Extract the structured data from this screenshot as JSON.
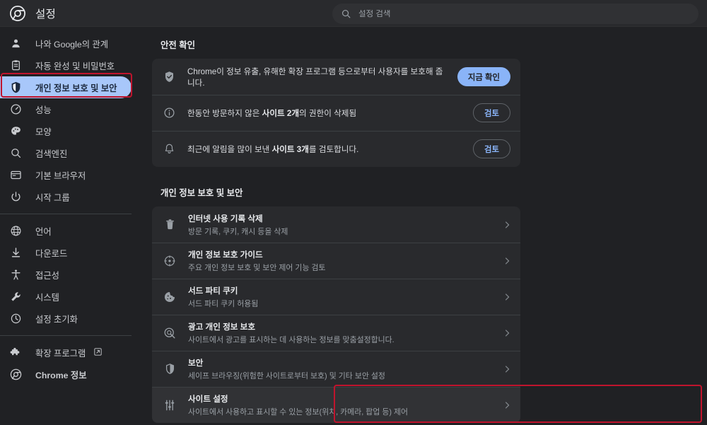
{
  "header": {
    "title": "설정",
    "logo_icon": "chrome-logo-icon"
  },
  "search": {
    "placeholder": "설정 검색",
    "value": "",
    "icon": "search-icon"
  },
  "sidebar": {
    "groups": [
      {
        "items": [
          {
            "label": "나와 Google의 관계",
            "icon": "person-icon",
            "selected": false
          },
          {
            "label": "자동 완성 및 비밀번호",
            "icon": "clipboard-icon",
            "selected": false
          },
          {
            "label": "개인 정보 보호 및 보안",
            "icon": "shield-icon",
            "selected": true
          },
          {
            "label": "성능",
            "icon": "gauge-icon",
            "selected": false
          },
          {
            "label": "모양",
            "icon": "palette-icon",
            "selected": false
          },
          {
            "label": "검색엔진",
            "icon": "search-icon",
            "selected": false
          },
          {
            "label": "기본 브라우저",
            "icon": "browser-window-icon",
            "selected": false
          },
          {
            "label": "시작 그룹",
            "icon": "power-icon",
            "selected": false
          }
        ]
      },
      {
        "items": [
          {
            "label": "언어",
            "icon": "globe-icon",
            "selected": false
          },
          {
            "label": "다운로드",
            "icon": "download-icon",
            "selected": false
          },
          {
            "label": "접근성",
            "icon": "accessibility-icon",
            "selected": false
          },
          {
            "label": "시스템",
            "icon": "wrench-icon",
            "selected": false
          },
          {
            "label": "설정 초기화",
            "icon": "history-restore-icon",
            "selected": false
          }
        ]
      },
      {
        "items": [
          {
            "label": "확장 프로그램",
            "icon": "puzzle-icon",
            "trailing_icon": "external-link-icon",
            "selected": false
          },
          {
            "label": "Chrome 정보",
            "icon": "chrome-logo-icon",
            "selected": false
          }
        ]
      }
    ]
  },
  "main": {
    "safety_check": {
      "title": "안전 확인",
      "rows": [
        {
          "icon": "shield-check-icon",
          "text_before": "Chrome이 정보 유출, 유해한 확장 프로그램 등으로부터 사용자를 보호해 줍니다.",
          "text_bold": "",
          "text_after": "",
          "button_label": "지금 확인",
          "button_style": "filled"
        },
        {
          "icon": "info-circle-icon",
          "text_before": "한동안 방문하지 않은 ",
          "text_bold": "사이트 2개",
          "text_after": "의 권한이 삭제됨",
          "button_label": "검토",
          "button_style": "outline"
        },
        {
          "icon": "bell-icon",
          "text_before": "최근에 알림을 많이 보낸 ",
          "text_bold": "사이트 3개",
          "text_after": "를 검토합니다.",
          "button_label": "검토",
          "button_style": "outline"
        }
      ]
    },
    "privacy": {
      "title": "개인 정보 보호 및 보안",
      "rows": [
        {
          "icon": "trash-icon",
          "title": "인터넷 사용 기록 삭제",
          "subtitle": "방문 기록, 쿠키, 캐시 등을 삭제",
          "hovered": false
        },
        {
          "icon": "compass-guide-icon",
          "title": "개인 정보 보호 가이드",
          "subtitle": "주요 개인 정보 보호 및 보안 제어 기능 검토",
          "hovered": false
        },
        {
          "icon": "cookie-icon",
          "title": "서드 파티 쿠키",
          "subtitle": "서드 파티 쿠키 허용됨",
          "hovered": false
        },
        {
          "icon": "ad-privacy-icon",
          "title": "광고 개인 정보 보호",
          "subtitle": "사이트에서 광고를 표시하는 데 사용하는 정보를 맞춤설정합니다.",
          "hovered": false
        },
        {
          "icon": "shield-icon",
          "title": "보안",
          "subtitle": "세이프 브라우징(위험한 사이트로부터 보호) 및 기타 보안 설정",
          "hovered": false
        },
        {
          "icon": "tune-sliders-icon",
          "title": "사이트 설정",
          "subtitle": "사이트에서 사용하고 표시할 수 있는 정보(위치, 카메라, 팝업 등) 제어",
          "hovered": true
        }
      ]
    }
  },
  "annotations": {
    "highlight_color": "#c0142d",
    "boxes": [
      {
        "name": "nav-privacy-highlight"
      },
      {
        "name": "site-settings-highlight"
      }
    ]
  },
  "colors": {
    "page_bg": "#202124",
    "card_bg": "#292a2d",
    "accent_blue": "#8ab4f8",
    "selected_pill": "#a8c7fa",
    "text_primary": "#e8eaed",
    "text_secondary": "#9aa0a6"
  }
}
